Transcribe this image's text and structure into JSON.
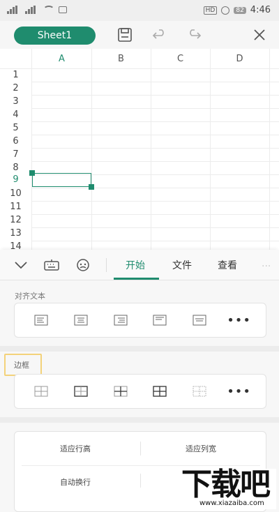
{
  "status_bar": {
    "battery": "82",
    "time": "4:46",
    "hd": "HD"
  },
  "toolbar": {
    "sheet_name": "Sheet1"
  },
  "grid": {
    "columns": [
      "A",
      "B",
      "C",
      "D"
    ],
    "rows": [
      "1",
      "2",
      "3",
      "4",
      "5",
      "6",
      "7",
      "8",
      "9",
      "10",
      "11",
      "12",
      "13",
      "14"
    ],
    "active_column": "A",
    "active_row": "9"
  },
  "panel": {
    "tabs": [
      "开始",
      "文件",
      "查看",
      "..."
    ],
    "active_tab": "开始",
    "align_label": "对齐文本",
    "border_label": "边框",
    "options": {
      "fit_row_height": "适应行高",
      "fit_col_width": "适应列宽",
      "wrap_text": "自动换行"
    },
    "more": "•••"
  },
  "watermark": {
    "big": "下载吧",
    "small": "www.xiazaiba.com"
  },
  "colors": {
    "accent": "#1f8c6e",
    "highlight": "#f3d27a"
  }
}
